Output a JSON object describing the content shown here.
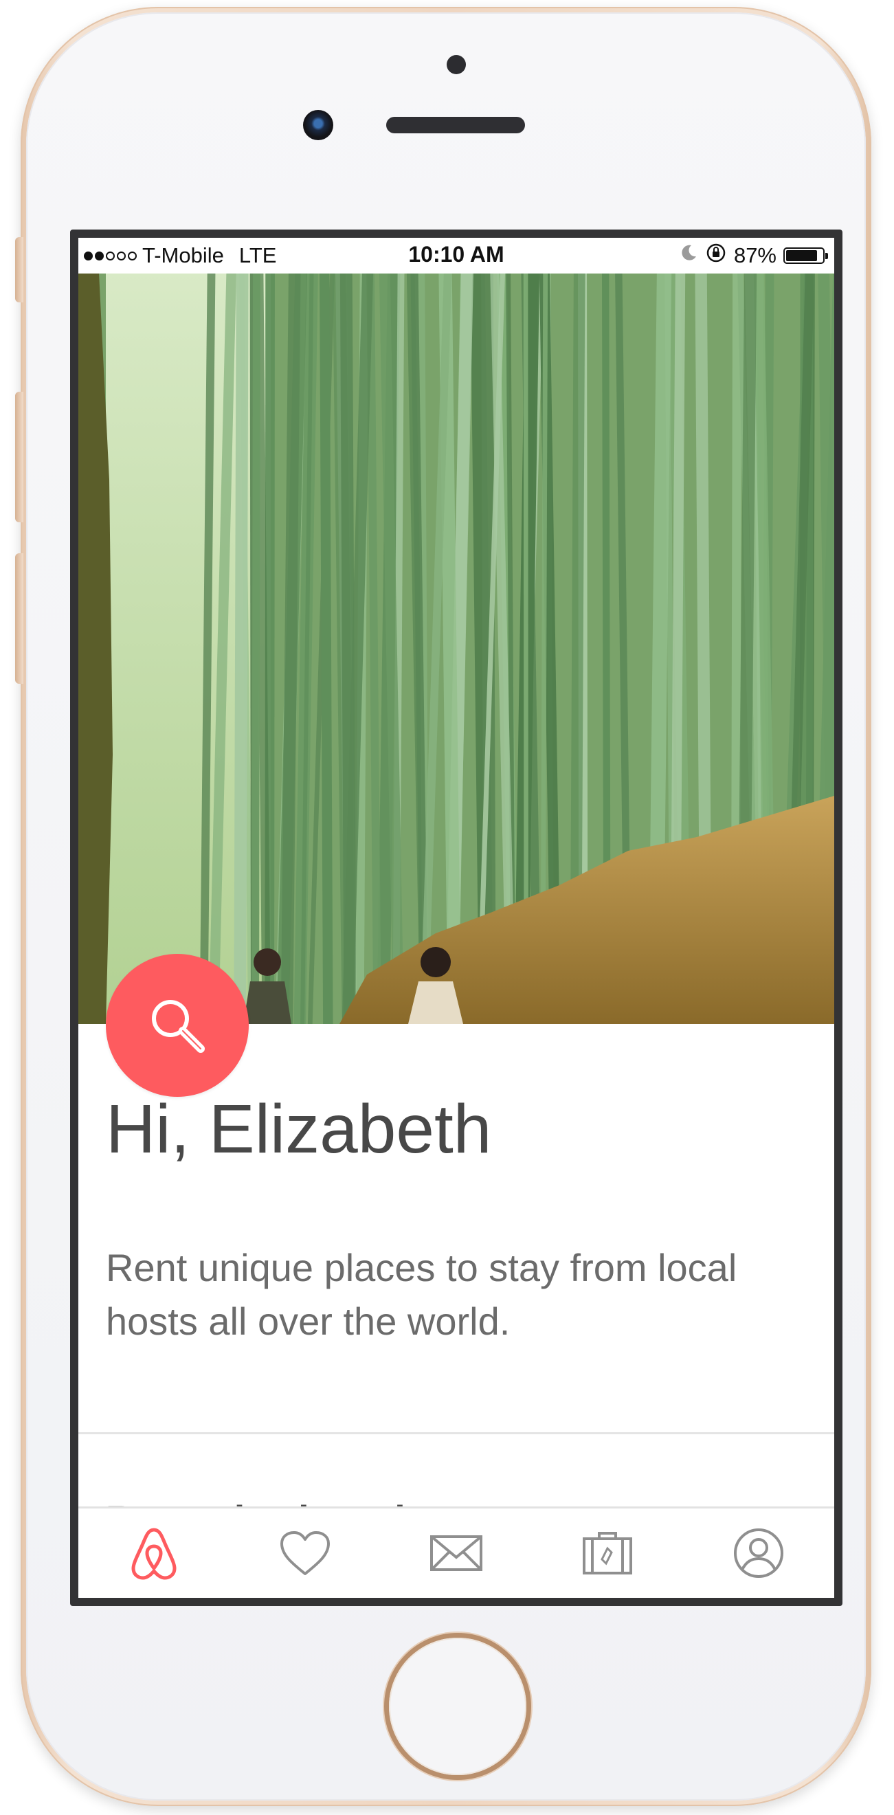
{
  "status_bar": {
    "carrier": "T-Mobile",
    "network": "LTE",
    "time": "10:10 AM",
    "battery": "87%",
    "battery_level": 0.87,
    "signal_bars_on": 2,
    "signal_bars_total": 5
  },
  "hero": {
    "image_description_icon": "bamboo-forest-photo"
  },
  "search_fab": {
    "icon": "search-icon",
    "color": "#fe5b5f"
  },
  "greeting": "Hi, Elizabeth",
  "tagline": "Rent unique places to stay from local hosts all over the world.",
  "section_heading": "Recently viewed",
  "tab_bar": {
    "active_color": "#fe5b5f",
    "inactive_color": "#8f8f8f",
    "tabs": [
      {
        "icon": "airbnb-logo-icon",
        "active": true
      },
      {
        "icon": "heart-icon",
        "active": false
      },
      {
        "icon": "envelope-icon",
        "active": false
      },
      {
        "icon": "suitcase-icon",
        "active": false
      },
      {
        "icon": "profile-icon",
        "active": false
      }
    ]
  }
}
